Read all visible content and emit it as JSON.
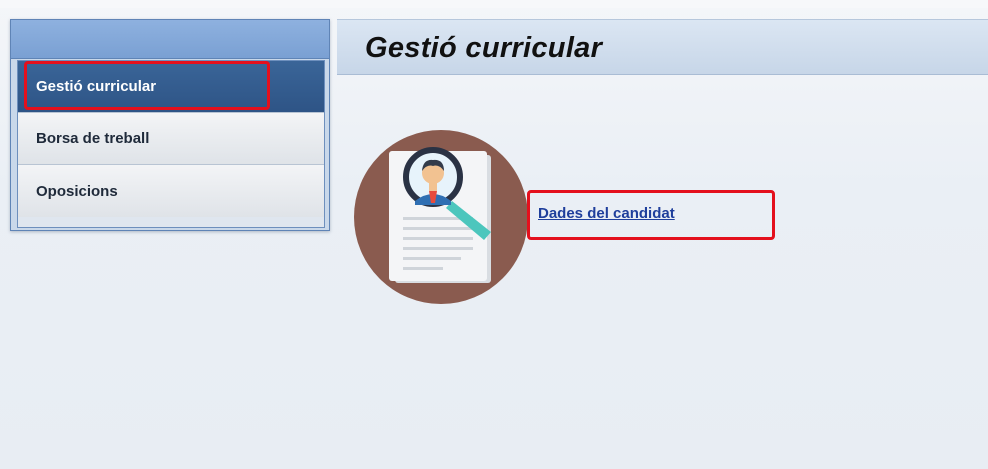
{
  "sidebar": {
    "items": [
      {
        "label": "Gestió curricular"
      },
      {
        "label": "Borsa de treball"
      },
      {
        "label": "Oposicions"
      }
    ]
  },
  "main": {
    "title": "Gestió curricular",
    "link_label": "Dades del candidat",
    "icon": "resume-magnifier-icon"
  },
  "colors": {
    "sidebar_active": "#2e5486",
    "highlight": "#e4101d",
    "link": "#1f3f9c",
    "icon_circle": "#8a5b4f"
  }
}
